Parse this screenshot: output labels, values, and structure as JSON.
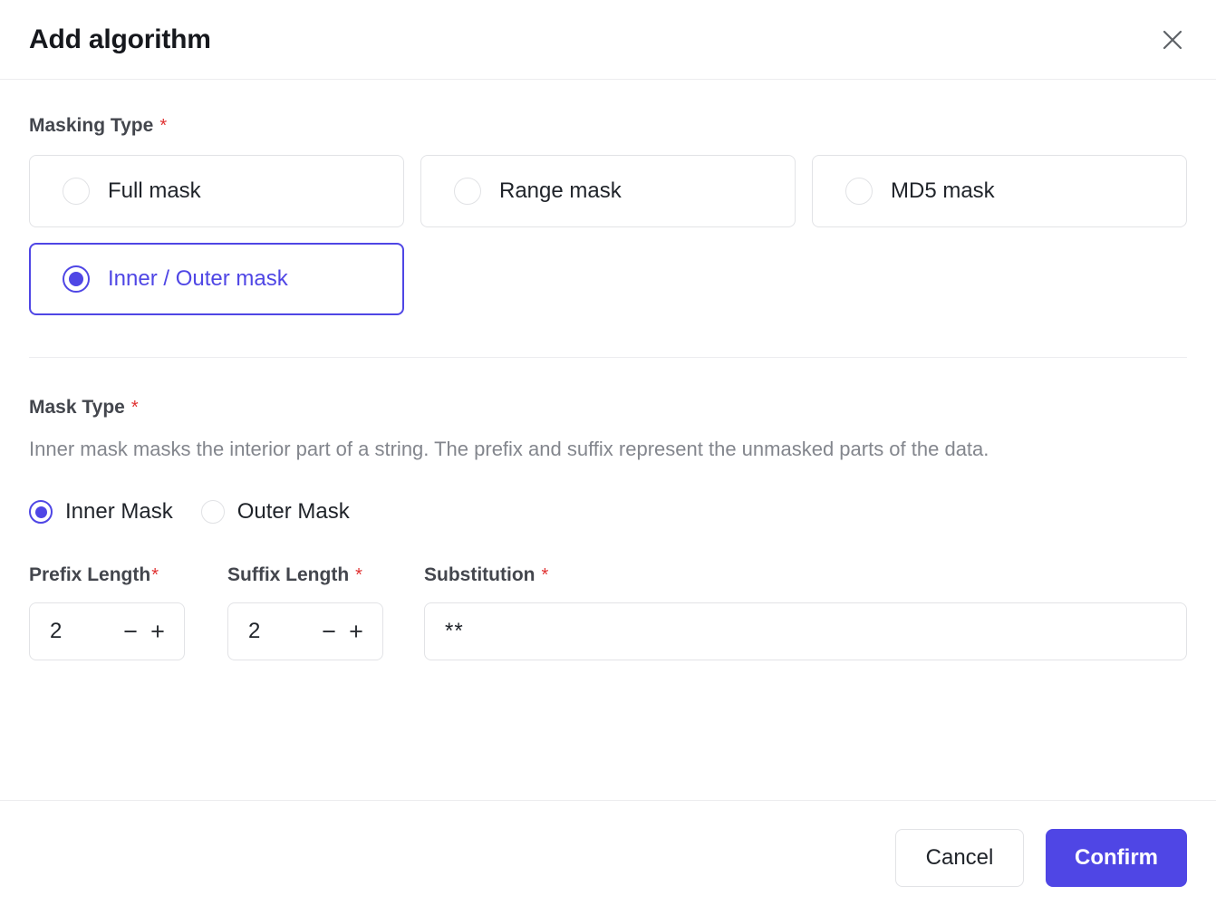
{
  "header": {
    "title": "Add algorithm",
    "close_icon": "close-icon"
  },
  "masking_type": {
    "label": "Masking Type",
    "required_marker": "*",
    "selected": "Inner / Outer mask",
    "options": [
      {
        "label": "Full mask",
        "selected": false
      },
      {
        "label": "Range mask",
        "selected": false
      },
      {
        "label": "MD5 mask",
        "selected": false
      },
      {
        "label": "Inner / Outer mask",
        "selected": true
      }
    ]
  },
  "mask_type": {
    "label": "Mask Type",
    "required_marker": "*",
    "description": "Inner mask masks the interior part of a string. The prefix and suffix represent the unmasked parts of the data.",
    "selected": "Inner Mask",
    "options": [
      {
        "label": "Inner Mask",
        "selected": true
      },
      {
        "label": "Outer Mask",
        "selected": false
      }
    ]
  },
  "fields": {
    "prefix_length": {
      "label": "Prefix Length",
      "required_marker": "*",
      "value": "2",
      "decrement_label": "−",
      "increment_label": "+"
    },
    "suffix_length": {
      "label": "Suffix Length",
      "required_marker": "*",
      "value": "2",
      "decrement_label": "−",
      "increment_label": "+"
    },
    "substitution": {
      "label": "Substitution",
      "required_marker": "*",
      "value": "**",
      "placeholder": ""
    }
  },
  "footer": {
    "cancel_label": "Cancel",
    "confirm_label": "Confirm"
  },
  "colors": {
    "accent": "#4F46E5",
    "required": "#E03131",
    "border": "#E2E3E6",
    "divider": "#ECECEF",
    "muted_text": "#83868D"
  }
}
